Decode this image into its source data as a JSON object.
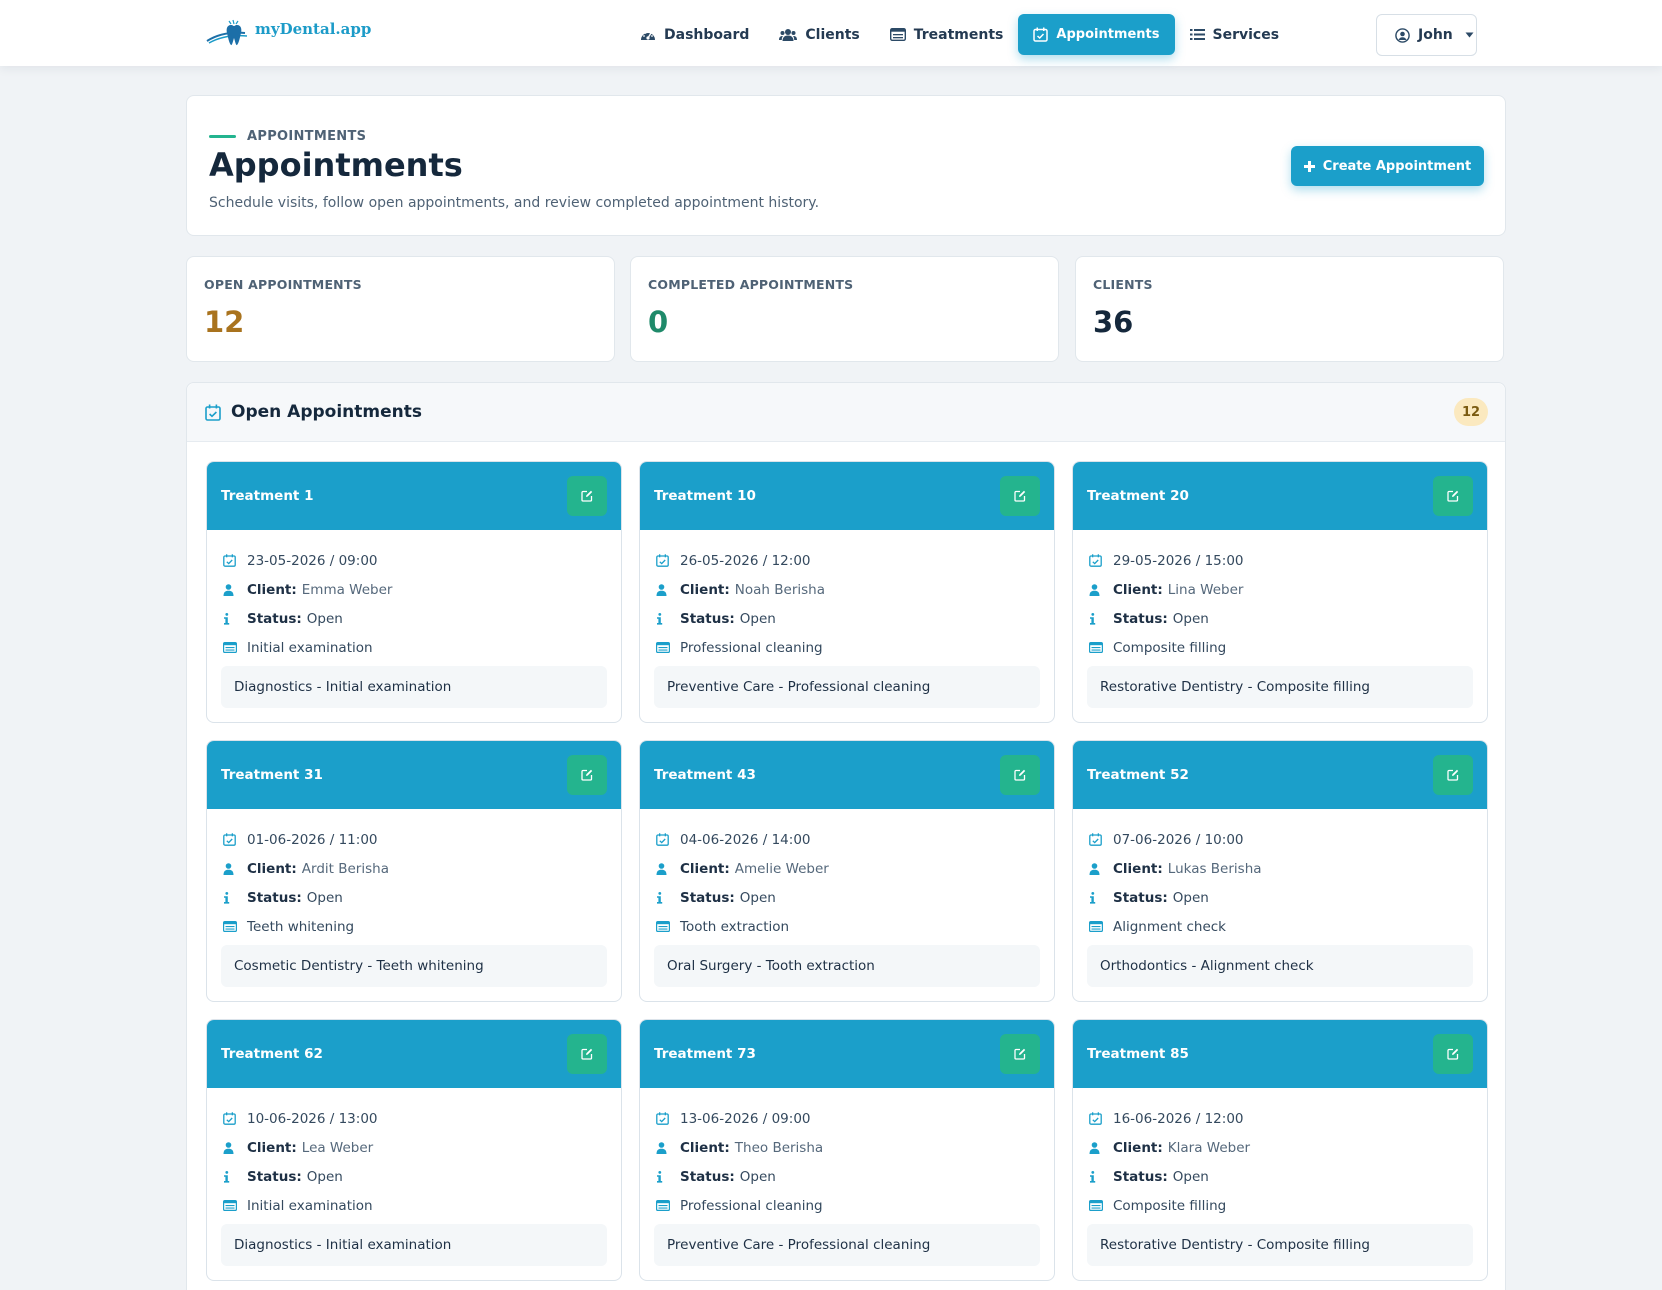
{
  "brand": {
    "name": "myDental.app"
  },
  "nav": {
    "items": [
      {
        "label": "Dashboard",
        "icon": "dashboard-icon",
        "active": false
      },
      {
        "label": "Clients",
        "icon": "users-icon",
        "active": false
      },
      {
        "label": "Treatments",
        "icon": "list-card-icon",
        "active": false
      },
      {
        "label": "Appointments",
        "icon": "calendar-check-icon",
        "active": true
      },
      {
        "label": "Services",
        "icon": "list-icon",
        "active": false
      }
    ],
    "user": "John"
  },
  "header": {
    "eyebrow": "APPOINTMENTS",
    "title": "Appointments",
    "subtitle": "Schedule visits, follow open appointments, and review completed appointment history.",
    "create_label": "Create Appointment"
  },
  "stats": [
    {
      "label": "OPEN APPOINTMENTS",
      "value": "12",
      "color": "#a9731e"
    },
    {
      "label": "COMPLETED APPOINTMENTS",
      "value": "0",
      "color": "#1f8a6a"
    },
    {
      "label": "CLIENTS",
      "value": "36",
      "color": "#15283c"
    }
  ],
  "open_panel": {
    "title": "Open Appointments",
    "count": "12",
    "labels": {
      "client": "Client:",
      "status": "Status:"
    },
    "appointments": [
      {
        "title": "Treatment 1",
        "datetime": "23-05-2026 / 09:00",
        "client": "Emma Weber",
        "status": "Open",
        "treatment": "Initial examination",
        "service": "Diagnostics - Initial examination"
      },
      {
        "title": "Treatment 10",
        "datetime": "26-05-2026 / 12:00",
        "client": "Noah Berisha",
        "status": "Open",
        "treatment": "Professional cleaning",
        "service": "Preventive Care - Professional cleaning"
      },
      {
        "title": "Treatment 20",
        "datetime": "29-05-2026 / 15:00",
        "client": "Lina Weber",
        "status": "Open",
        "treatment": "Composite filling",
        "service": "Restorative Dentistry - Composite filling"
      },
      {
        "title": "Treatment 31",
        "datetime": "01-06-2026 / 11:00",
        "client": "Ardit Berisha",
        "status": "Open",
        "treatment": "Teeth whitening",
        "service": "Cosmetic Dentistry - Teeth whitening"
      },
      {
        "title": "Treatment 43",
        "datetime": "04-06-2026 / 14:00",
        "client": "Amelie Weber",
        "status": "Open",
        "treatment": "Tooth extraction",
        "service": "Oral Surgery - Tooth extraction"
      },
      {
        "title": "Treatment 52",
        "datetime": "07-06-2026 / 10:00",
        "client": "Lukas Berisha",
        "status": "Open",
        "treatment": "Alignment check",
        "service": "Orthodontics - Alignment check"
      },
      {
        "title": "Treatment 62",
        "datetime": "10-06-2026 / 13:00",
        "client": "Lea Weber",
        "status": "Open",
        "treatment": "Initial examination",
        "service": "Diagnostics - Initial examination"
      },
      {
        "title": "Treatment 73",
        "datetime": "13-06-2026 / 09:00",
        "client": "Theo Berisha",
        "status": "Open",
        "treatment": "Professional cleaning",
        "service": "Preventive Care - Professional cleaning"
      },
      {
        "title": "Treatment 85",
        "datetime": "16-06-2026 / 12:00",
        "client": "Klara Weber",
        "status": "Open",
        "treatment": "Composite filling",
        "service": "Restorative Dentistry - Composite filling"
      }
    ]
  },
  "colors": {
    "primary": "#1b9fca",
    "success": "#24b48e",
    "badge_bg": "#fbe9bf"
  }
}
